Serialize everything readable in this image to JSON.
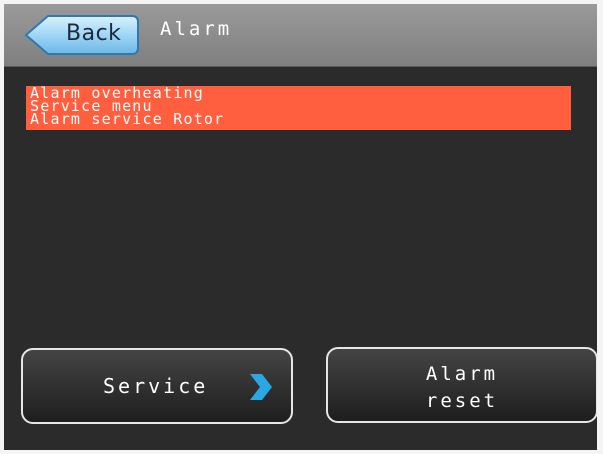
{
  "header": {
    "back_label": "Back",
    "title": "Alarm"
  },
  "alarms": [
    "Alarm overheating",
    "Service menu",
    "Alarm service Rotor"
  ],
  "buttons": {
    "service_label": "Service",
    "service_icon": "chevron-right-icon",
    "alarm_reset_line1": "Alarm",
    "alarm_reset_line2": "reset"
  },
  "colors": {
    "alarm_highlight": "#ff5f3f",
    "accent_blue": "#2aa8e6"
  }
}
